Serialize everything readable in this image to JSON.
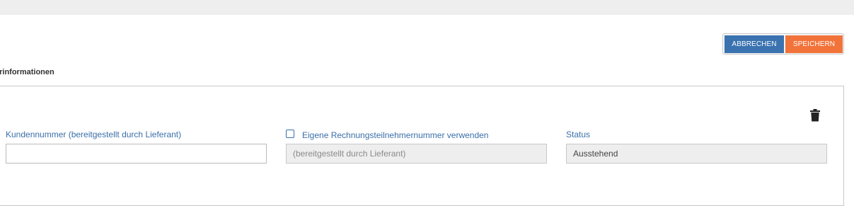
{
  "actions": {
    "cancel_label": "ABBRECHEN",
    "save_label": "SPEICHERN"
  },
  "section": {
    "title": "erinformationen"
  },
  "form": {
    "kundennummer": {
      "label": "Kundennummer (bereitgestellt durch Lieferant)",
      "value": ""
    },
    "eigene_nummer": {
      "checkbox_label": "Eigene Rechnungsteilnehmernummer verwenden",
      "checked": false,
      "placeholder": "(bereitgestellt durch Lieferant)"
    },
    "status": {
      "label": "Status",
      "value": "Ausstehend"
    }
  },
  "icons": {
    "delete": "trash-icon"
  },
  "colors": {
    "primary_blue": "#3a73b0",
    "accent_orange": "#f2733a",
    "label_blue": "#3a6fa8"
  }
}
